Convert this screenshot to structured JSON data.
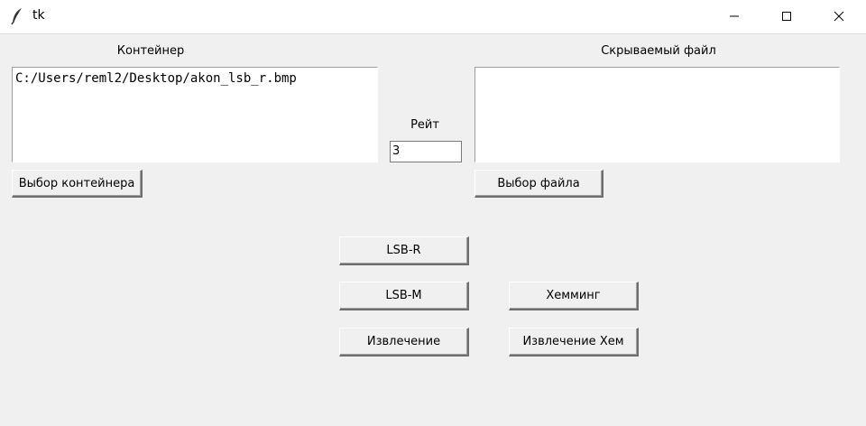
{
  "window": {
    "title": "tk",
    "icon": "feather-icon",
    "controls": {
      "minimize_icon": "minimize-icon",
      "maximize_icon": "maximize-icon",
      "close_icon": "close-icon"
    }
  },
  "container": {
    "label": "Контейнер",
    "path": "C:/Users/reml2/Desktop/akon_lsb_r.bmp",
    "select_button": "Выбор контейнера"
  },
  "rate": {
    "label": "Рейт",
    "value": "3"
  },
  "hidden_file": {
    "label": "Скрываемый файл",
    "path": "",
    "select_button": "Выбор файла"
  },
  "actions": {
    "lsb_r": "LSB-R",
    "lsb_m": "LSB-M",
    "extract": "Извлечение",
    "hamming": "Хемминг",
    "extract_hamming": "Извлечение Хем"
  }
}
